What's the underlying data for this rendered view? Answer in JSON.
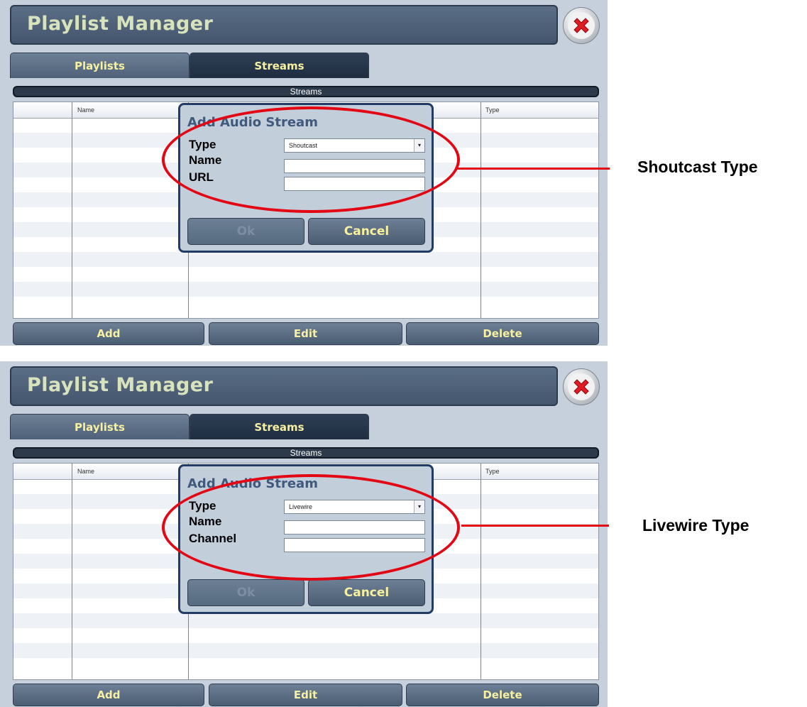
{
  "screenshots": [
    {
      "window": {
        "title": "Playlist Manager"
      },
      "tabs": [
        {
          "label": "Playlists"
        },
        {
          "label": "Streams"
        }
      ],
      "section_title": "Streams",
      "table": {
        "columns": [
          "Name",
          "Type"
        ]
      },
      "dialog": {
        "title": "Add Audio Stream",
        "fields": [
          {
            "label": "Type",
            "value": "Shoutcast"
          },
          {
            "label": "Name",
            "value": ""
          },
          {
            "label": "URL",
            "value": ""
          }
        ],
        "ok_label": "Ok",
        "cancel_label": "Cancel"
      },
      "bottom_buttons": {
        "add": "Add",
        "edit": "Edit",
        "delete": "Delete"
      },
      "callout": "Shoutcast Type"
    },
    {
      "window": {
        "title": "Playlist Manager"
      },
      "tabs": [
        {
          "label": "Playlists"
        },
        {
          "label": "Streams"
        }
      ],
      "section_title": "Streams",
      "table": {
        "columns": [
          "Name",
          "Type"
        ]
      },
      "dialog": {
        "title": "Add Audio Stream",
        "fields": [
          {
            "label": "Type",
            "value": "Livewire"
          },
          {
            "label": "Name",
            "value": ""
          },
          {
            "label": "Channel",
            "value": ""
          }
        ],
        "ok_label": "Ok",
        "cancel_label": "Cancel"
      },
      "bottom_buttons": {
        "add": "Add",
        "edit": "Edit",
        "delete": "Delete"
      },
      "callout": "Livewire Type"
    }
  ],
  "colors": {
    "highlight": "#e30613",
    "button_text": "#f6f0a0",
    "title_text": "#d8e3bc",
    "dialog_border": "#1f3b66"
  },
  "icons": {
    "close": "red-x-close-icon",
    "dropdown": "chevron-down-icon"
  }
}
